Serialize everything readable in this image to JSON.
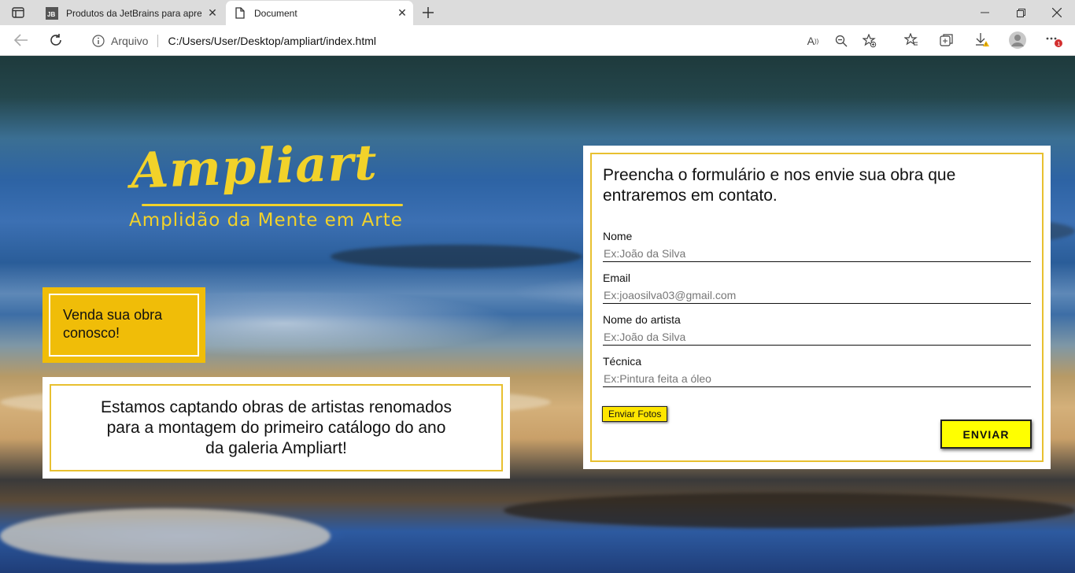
{
  "browser": {
    "tabs": [
      {
        "title": "Produtos da JetBrains para apren",
        "favicon": "jetbrains-icon",
        "active": false
      },
      {
        "title": "Document",
        "favicon": "document-icon",
        "active": true
      }
    ],
    "address": {
      "scheme_label": "Arquivo",
      "url": "C:/Users/User/Desktop/ampliart/index.html"
    },
    "jetbrains_badge": "JB",
    "notification_badge": "1"
  },
  "page": {
    "logo": {
      "title": "Ampliart",
      "subtitle": "Amplidão da Mente em Arte",
      "color": "#f2d22a"
    },
    "sell_box": {
      "text": "Venda sua obra conosco!",
      "color": "#f0bd08"
    },
    "info_box": {
      "text": "Estamos captando obras de artistas renomados para a montagem do primeiro catálogo do ano da galeria Ampliart!"
    },
    "form": {
      "heading": "Preencha o formulário e nos envie sua obra que entraremos em contato.",
      "fields": [
        {
          "label": "Nome",
          "placeholder": "Ex:João da Silva",
          "value": ""
        },
        {
          "label": "Email",
          "placeholder": "Ex:joaosilva03@gmail.com",
          "value": ""
        },
        {
          "label": "Nome do artista",
          "placeholder": "Ex:João da Silva",
          "value": ""
        },
        {
          "label": "Técnica",
          "placeholder": "Ex:Pintura feita a óleo",
          "value": ""
        }
      ],
      "photos_button": "Enviar Fotos",
      "submit_button": "ENVIAR",
      "accent_color": "#ffff00"
    }
  }
}
